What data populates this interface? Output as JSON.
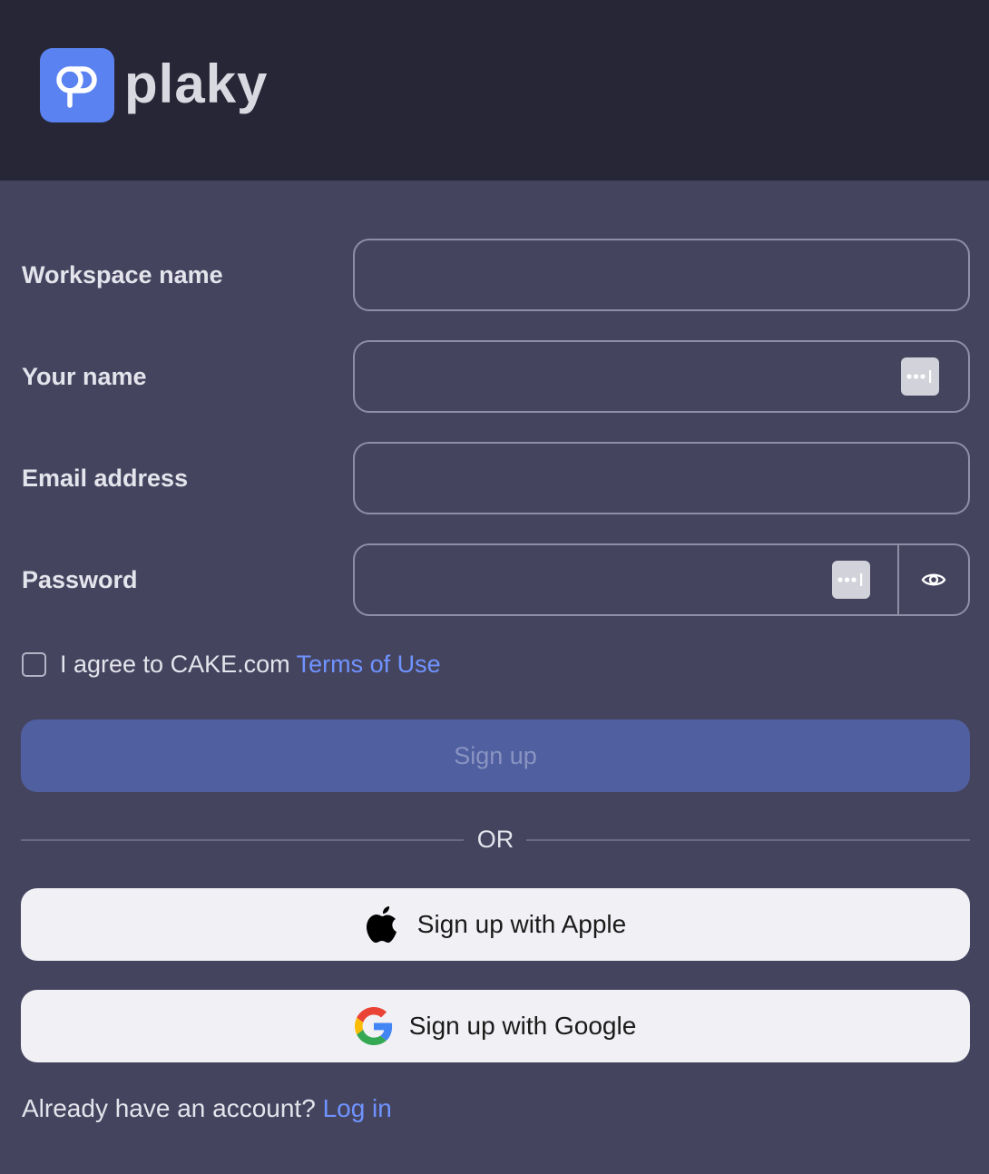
{
  "brand": {
    "name": "plaky",
    "accent": "#5a82f0"
  },
  "form": {
    "workspace_label": "Workspace name",
    "workspace_value": "",
    "name_label": "Your name",
    "name_value": "",
    "email_label": "Email address",
    "email_value": "",
    "password_label": "Password",
    "password_value": ""
  },
  "agree": {
    "text": "I agree to CAKE.com",
    "link": "Terms of Use"
  },
  "signup_button": "Sign up",
  "divider": "OR",
  "social": {
    "apple": "Sign up with Apple",
    "google": "Sign up with Google"
  },
  "footer": {
    "text": "Already have an account?",
    "link": "Log in"
  },
  "icons": {
    "logo": "plaky-logo-icon",
    "password_manager": "password-manager-icon",
    "show_password": "eye-icon",
    "apple": "apple-icon",
    "google": "google-icon"
  },
  "colors": {
    "header_bg": "#262636",
    "page_bg": "#45445f",
    "link": "#6f93ff",
    "signup_bg": "#4f5fa0"
  }
}
